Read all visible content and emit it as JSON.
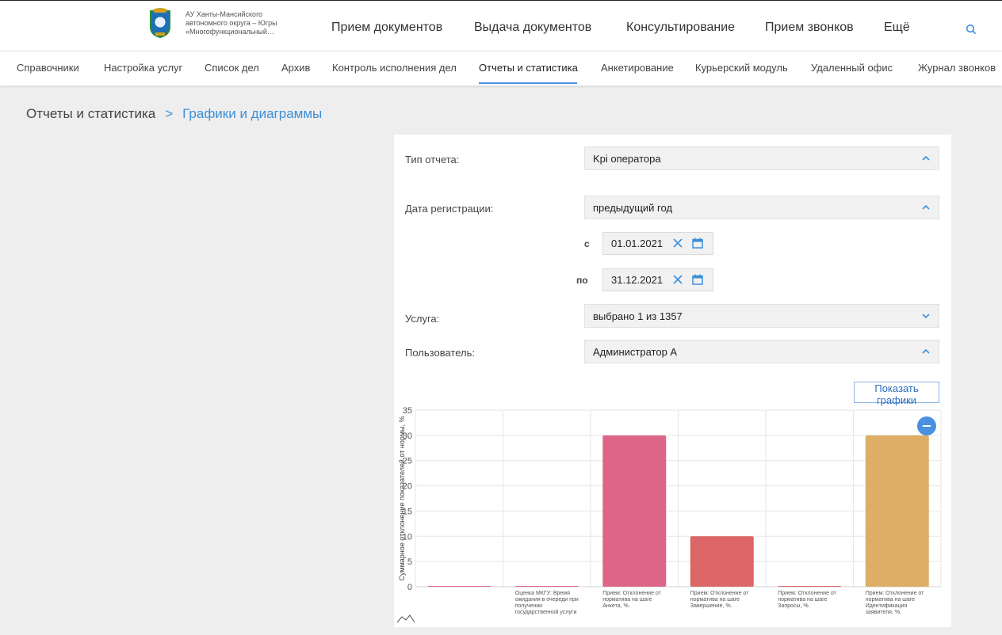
{
  "header": {
    "org_line1": "АУ Ханты-Мансийского",
    "org_line2": "автономного округа – Югры",
    "org_line3": "«Многофункциональный…",
    "nav": [
      "Прием документов",
      "Выдача документов",
      "Консультирование",
      "Прием звонков",
      "Ещё"
    ]
  },
  "subnav": {
    "items": [
      "Справочники",
      "Настройка услуг",
      "Список дел",
      "Архив",
      "Контроль исполнения дел",
      "Отчеты и статистика",
      "Анкетирование",
      "Курьерский модуль",
      "Удаленный офис",
      "Журнал звонков"
    ],
    "active": "Отчеты и статистика"
  },
  "breadcrumb": {
    "root": "Отчеты и статистика",
    "separator": ">",
    "current": "Графики и диаграммы"
  },
  "form": {
    "report_type": {
      "label": "Тип отчета:",
      "value": "Kpi оператора"
    },
    "reg_date": {
      "label": "Дата регистрации:",
      "value": "предыдущий год"
    },
    "date_from": {
      "prefix": "с",
      "value": "01.01.2021"
    },
    "date_to": {
      "prefix": "по",
      "value": "31.12.2021"
    },
    "service": {
      "label": "Услуга:",
      "value": "выбрано 1 из 1357"
    },
    "user": {
      "label": "Пользователь:",
      "value": "Администратор А"
    },
    "show_button": "Показать графики"
  },
  "colors": {
    "accent": "#3b8fd9",
    "bar_pink": "#dd6688",
    "bar_red": "#dd6666",
    "bar_gold": "#dcae66",
    "zoom": "#4a8fe0"
  },
  "chart_data": {
    "type": "bar",
    "ylabel": "Суммарное отклонение показателей от нормы, %",
    "ylim": [
      0,
      35
    ],
    "yticks": [
      0,
      5,
      10,
      15,
      20,
      25,
      30,
      35
    ],
    "categories": [
      "",
      "Оценка МКГУ: Время ожидания в очереди при получении государственной услуги",
      "Прием: Отклонение от норматива на шаге Анкета, %.",
      "Прием: Отклонение от норматива на шаге Завершение, %.",
      "Прием: Отклонение от норматива на шаге Запросы, %.",
      "Прием: Отклонение от норматива на шаге Идентификация заявителя, %."
    ],
    "values": [
      0,
      0,
      30,
      10,
      0,
      30
    ],
    "bar_colors": [
      "#dd6688",
      "#dd6688",
      "#dd6688",
      "#dd6666",
      "#dd6666",
      "#dcae66"
    ],
    "grid": true
  }
}
